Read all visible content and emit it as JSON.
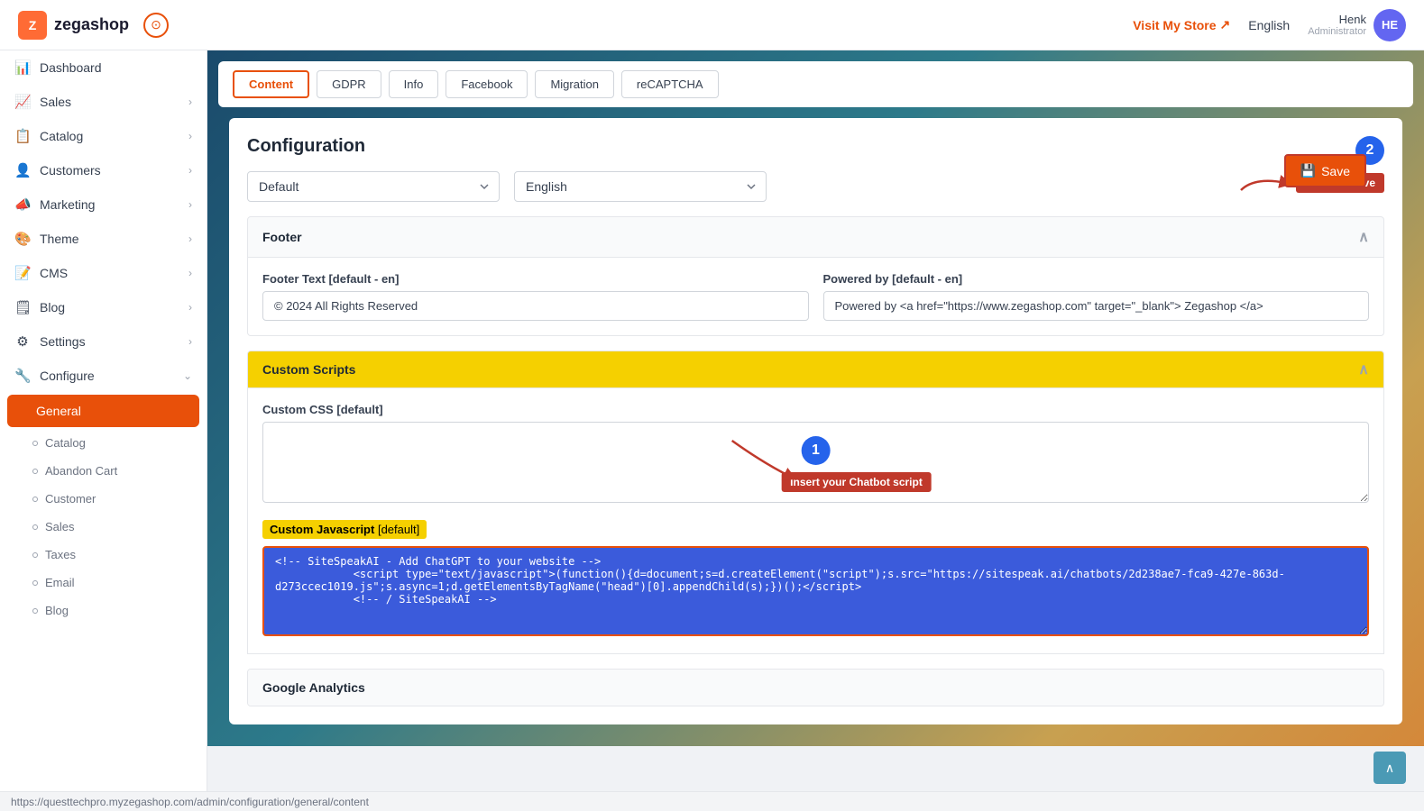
{
  "header": {
    "logo_text": "zegashop",
    "visit_store_label": "Visit My Store",
    "language_label": "English",
    "user_name": "Henk",
    "user_role": "Administrator",
    "user_initials": "HE"
  },
  "sidebar": {
    "items": [
      {
        "id": "dashboard",
        "label": "Dashboard",
        "icon": "📊",
        "has_children": false
      },
      {
        "id": "sales",
        "label": "Sales",
        "icon": "📈",
        "has_children": true
      },
      {
        "id": "catalog",
        "label": "Catalog",
        "icon": "📋",
        "has_children": true
      },
      {
        "id": "customers",
        "label": "Customers",
        "icon": "👤",
        "has_children": true
      },
      {
        "id": "marketing",
        "label": "Marketing",
        "icon": "📣",
        "has_children": true
      },
      {
        "id": "theme",
        "label": "Theme",
        "icon": "🎨",
        "has_children": true
      },
      {
        "id": "cms",
        "label": "CMS",
        "icon": "📝",
        "has_children": true
      },
      {
        "id": "blog",
        "label": "Blog",
        "icon": "🗒",
        "has_children": true
      },
      {
        "id": "settings",
        "label": "Settings",
        "icon": "⚙",
        "has_children": true
      },
      {
        "id": "configure",
        "label": "Configure",
        "icon": "🔧",
        "has_children": true
      }
    ],
    "sub_items": [
      {
        "id": "general",
        "label": "General",
        "active": true
      },
      {
        "id": "catalog-sub",
        "label": "Catalog",
        "active": false
      },
      {
        "id": "abandon-cart",
        "label": "Abandon Cart",
        "active": false
      },
      {
        "id": "customer",
        "label": "Customer",
        "active": false
      },
      {
        "id": "sales-sub",
        "label": "Sales",
        "active": false
      },
      {
        "id": "taxes",
        "label": "Taxes",
        "active": false
      },
      {
        "id": "email",
        "label": "Email",
        "active": false
      },
      {
        "id": "blog-sub",
        "label": "Blog",
        "active": false
      }
    ]
  },
  "tabs": [
    {
      "id": "content",
      "label": "Content",
      "active": true
    },
    {
      "id": "gdpr",
      "label": "GDPR",
      "active": false
    },
    {
      "id": "info",
      "label": "Info",
      "active": false
    },
    {
      "id": "facebook",
      "label": "Facebook",
      "active": false
    },
    {
      "id": "migration",
      "label": "Migration",
      "active": false
    },
    {
      "id": "recaptcha",
      "label": "reCAPTCHA",
      "active": false
    }
  ],
  "config": {
    "title": "Configuration",
    "save_label": "Save",
    "store_dropdown_value": "Default",
    "language_dropdown_value": "English",
    "footer_section_label": "Footer",
    "footer_text_label": "Footer Text",
    "footer_text_tag": "[default - en]",
    "footer_text_value": "© 2024 All Rights Reserved",
    "powered_by_label": "Powered by",
    "powered_by_tag": "[default - en]",
    "powered_by_value": "Powered by <a href=\"https://www.zegashop.com\" target=\"_blank\"> Zegashop </a>",
    "custom_scripts_label": "Custom Scripts",
    "custom_css_label": "Custom CSS",
    "custom_css_tag": "[default]",
    "custom_css_value": "",
    "custom_js_label": "Custom Javascript",
    "custom_js_tag": "[default]",
    "custom_js_value": "<!-- SiteSpeakAI - Add ChatGPT to your website -->\n            <script type=\"text/javascript\">(function(){d=document;s=d.createElement(\"script\");s.src=\"https://sitespeak.ai/chatbots/2d238ae7-fca9-427e-863d-d273ccec1019.js\";s.async=1;d.getElementsByTagName(\"head\")[0].appendChild(s);})();</script>\n            <!-- / SiteSpeakAI -->",
    "google_analytics_label": "Google Analytics",
    "step1_badge": "1",
    "step2_badge": "2",
    "annotation1_label": "Insert your Chatbot script",
    "annotation2_label": "Click on Save"
  },
  "status_bar": {
    "url": "https://questtechpro.myzegashop.com/admin/configuration/general/content"
  }
}
